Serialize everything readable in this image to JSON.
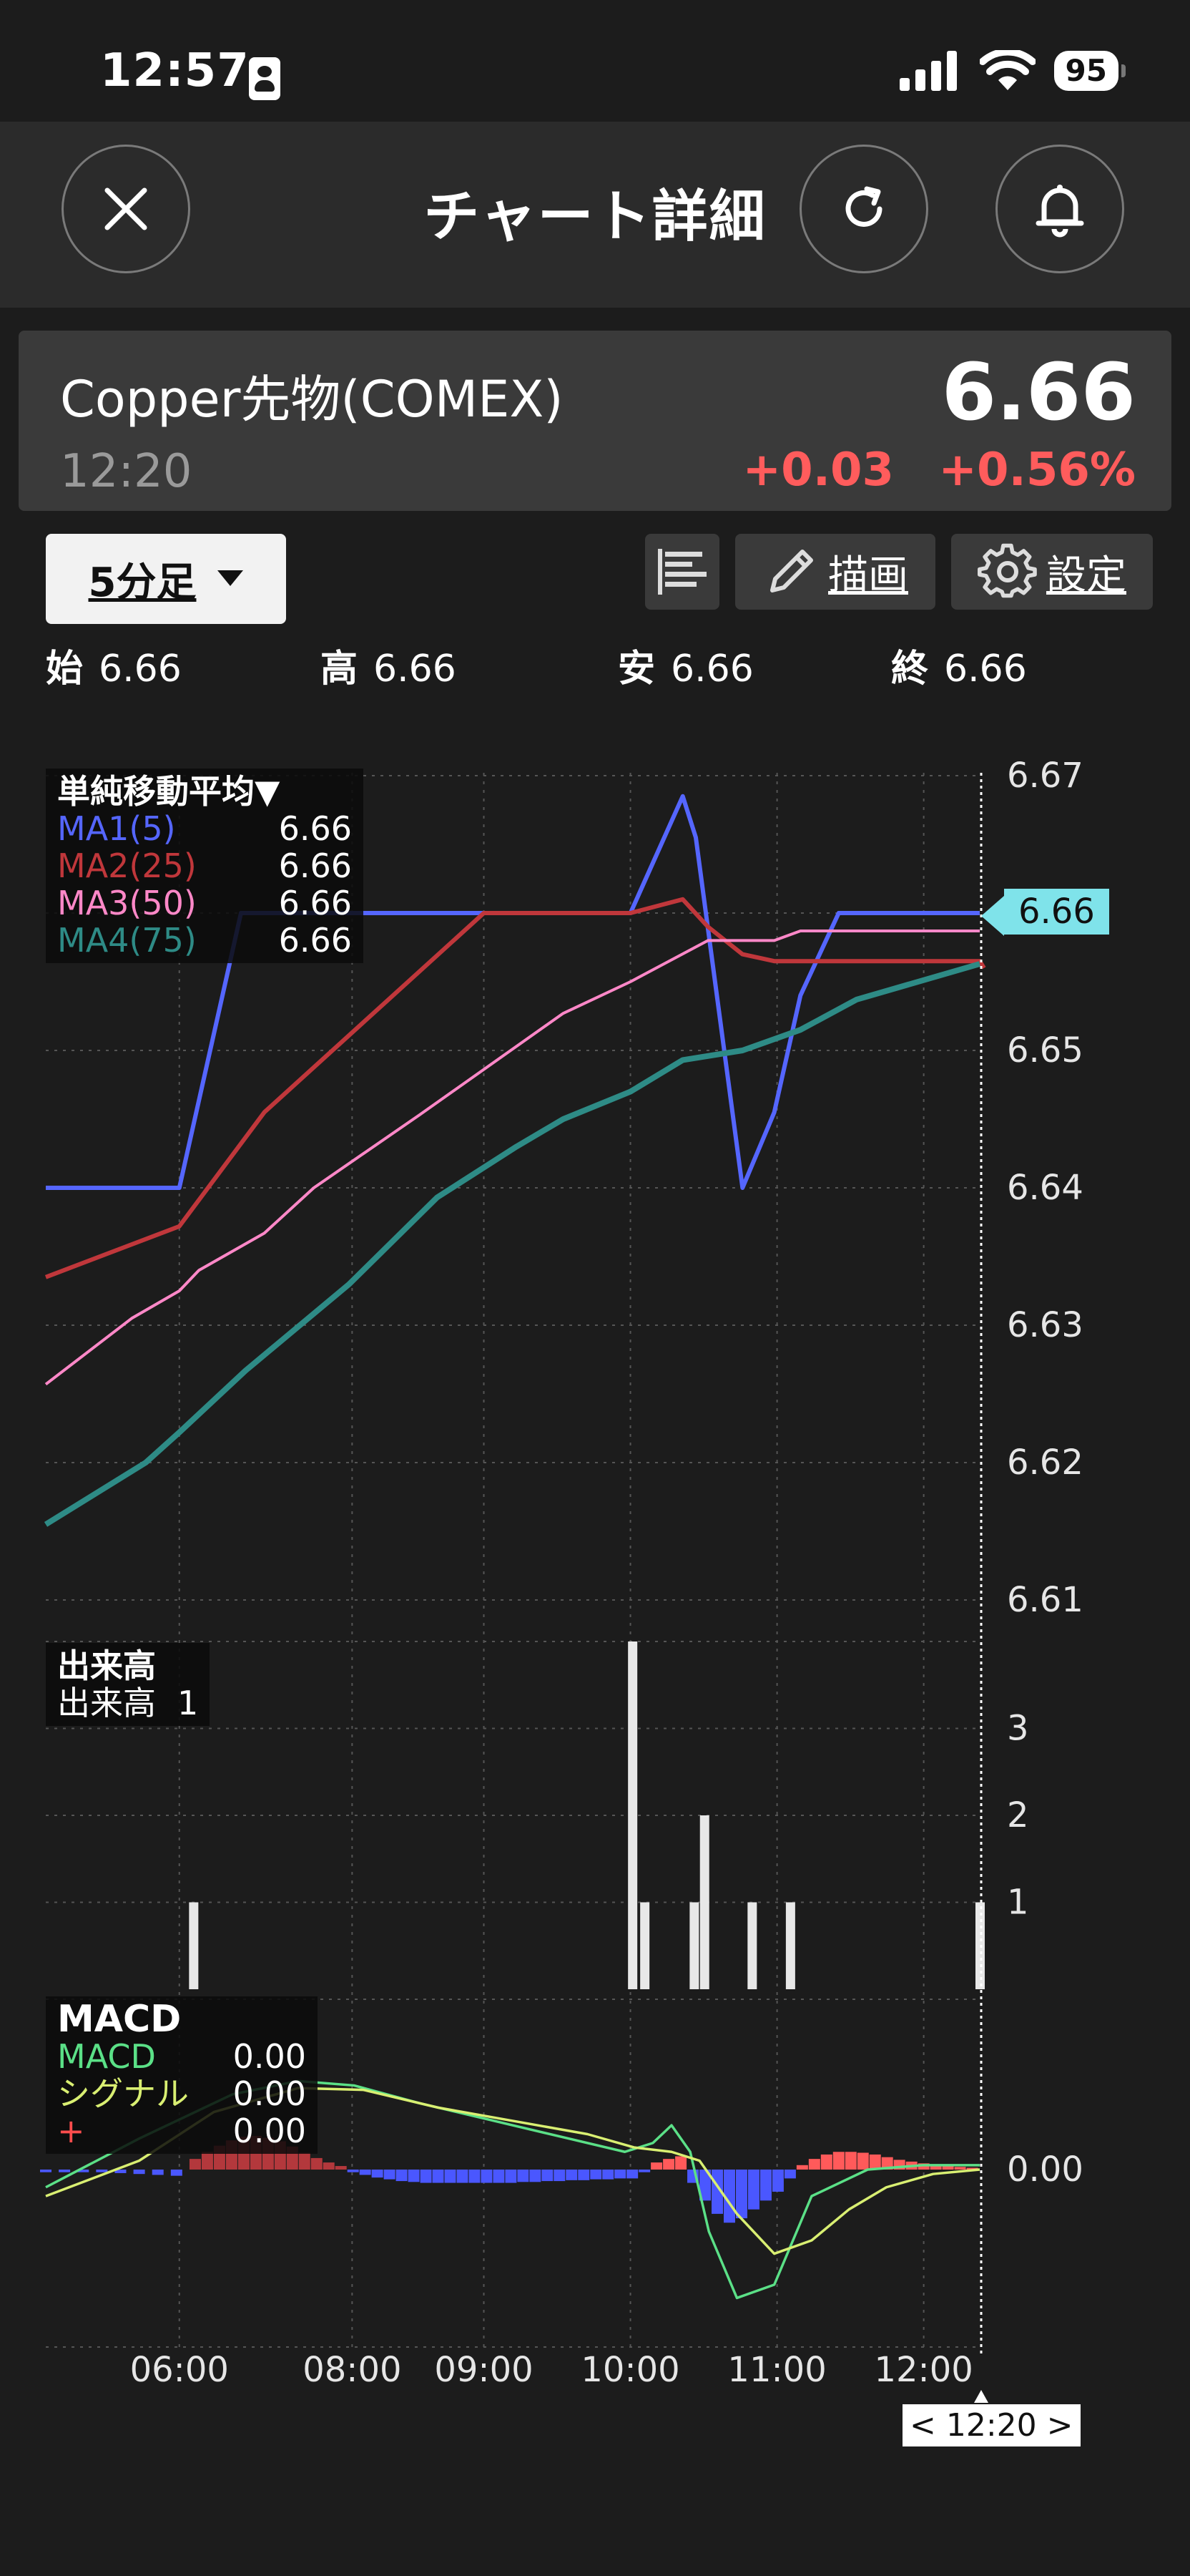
{
  "status_bar": {
    "time": "12:57",
    "battery": "95"
  },
  "header": {
    "title": "チャート詳細"
  },
  "quote": {
    "name": "Copper先物(COMEX)",
    "time": "12:20",
    "price": "6.66",
    "change": "+0.03",
    "change_pct": "+0.56%"
  },
  "toolbar": {
    "timeframe": "5分足",
    "draw_label": "描画",
    "settings_label": "設定"
  },
  "ohlc": [
    {
      "label": "始",
      "value": "6.66"
    },
    {
      "label": "高",
      "value": "6.66"
    },
    {
      "label": "安",
      "value": "6.66"
    },
    {
      "label": "終",
      "value": "6.66"
    }
  ],
  "legend_ma": {
    "title": "単純移動平均▼",
    "rows": [
      {
        "name": "MA1(5)",
        "value": "6.66",
        "color": "#5566ff"
      },
      {
        "name": "MA2(25)",
        "value": "6.66",
        "color": "#c0373b"
      },
      {
        "name": "MA3(50)",
        "value": "6.66",
        "color": "#ff88c8"
      },
      {
        "name": "MA4(75)",
        "value": "6.66",
        "color": "#2e8b86"
      }
    ]
  },
  "legend_volume": {
    "title": "出来高",
    "label": "出来高",
    "value": "1"
  },
  "legend_macd": {
    "title": "MACD",
    "rows": [
      {
        "name": "MACD",
        "value": "0.00",
        "color": "#5be087"
      },
      {
        "name": "シグナル",
        "value": "0.00",
        "color": "#d9ef72"
      },
      {
        "name": "+",
        "value": "0.00",
        "color": "#ff4d4d"
      }
    ]
  },
  "last_price_tag": "6.66",
  "cursor_time": "< 12:20 >",
  "chart_data": {
    "type": "line",
    "x_ticks": [
      "06:00",
      "08:00",
      "09:00",
      "10:00",
      "11:00",
      "12:00"
    ],
    "price_axis": {
      "ticks": [
        "6.67",
        "6.66",
        "6.65",
        "6.64",
        "6.63",
        "6.62",
        "6.61"
      ],
      "ylim": [
        6.61,
        6.67
      ]
    },
    "volume_axis": {
      "ticks": [
        "3",
        "2",
        "1"
      ],
      "ylim": [
        0,
        4
      ]
    },
    "macd_axis": {
      "ticks": [
        "0.00"
      ]
    },
    "x_range": [
      0,
      100
    ],
    "grid": true,
    "series": [
      {
        "name": "MA1(5)",
        "color": "#5566ff",
        "width": 6,
        "points": [
          [
            0,
            6.64
          ],
          [
            14.3,
            6.64
          ],
          [
            20.9,
            6.66
          ],
          [
            46.9,
            6.66
          ],
          [
            62.6,
            6.66
          ],
          [
            68.2,
            6.6685
          ],
          [
            69.6,
            6.6655
          ],
          [
            74.6,
            6.64
          ],
          [
            78.0,
            6.6455
          ],
          [
            80.8,
            6.654
          ],
          [
            84.9,
            6.66
          ],
          [
            100,
            6.66
          ]
        ]
      },
      {
        "name": "MA2(25)",
        "color": "#c0373b",
        "width": 6,
        "points": [
          [
            0,
            6.6335
          ],
          [
            14.3,
            6.6372
          ],
          [
            23.4,
            6.6455
          ],
          [
            46.9,
            6.66
          ],
          [
            62.6,
            6.66
          ],
          [
            68.2,
            6.661
          ],
          [
            70.9,
            6.659
          ],
          [
            74.6,
            6.657
          ],
          [
            78.0,
            6.6565
          ],
          [
            100,
            6.6565
          ],
          [
            104.3,
            6.656
          ]
        ]
      },
      {
        "name": "MA3(50)",
        "color": "#ff88c8",
        "width": 4,
        "points": [
          [
            0,
            6.6257
          ],
          [
            9.2,
            6.6305
          ],
          [
            14.3,
            6.6325
          ],
          [
            16.4,
            6.634
          ],
          [
            23.4,
            6.6367
          ],
          [
            28.7,
            6.64
          ],
          [
            40,
            6.6453
          ],
          [
            55.4,
            6.6527
          ],
          [
            62.6,
            6.655
          ],
          [
            70.9,
            6.658
          ],
          [
            78.0,
            6.658
          ],
          [
            80.8,
            6.6587
          ],
          [
            100,
            6.6587
          ]
        ]
      },
      {
        "name": "MA4(75)",
        "color": "#2e8b86",
        "width": 8,
        "points": [
          [
            0,
            6.6155
          ],
          [
            10.7,
            6.62
          ],
          [
            14.3,
            6.6222
          ],
          [
            21.4,
            6.6267
          ],
          [
            32.5,
            6.633
          ],
          [
            41.9,
            6.6393
          ],
          [
            50.4,
            6.643
          ],
          [
            55.4,
            6.645
          ],
          [
            62.6,
            6.647
          ],
          [
            68.2,
            6.6493
          ],
          [
            74.6,
            6.65
          ],
          [
            80.8,
            6.6515
          ],
          [
            86.8,
            6.6537
          ],
          [
            100,
            6.6563
          ]
        ]
      }
    ],
    "volume_bars": [
      [
        15.8,
        1
      ],
      [
        62.8,
        4
      ],
      [
        64.1,
        1
      ],
      [
        69.4,
        1
      ],
      [
        70.5,
        2
      ],
      [
        75.6,
        1
      ],
      [
        79.7,
        1
      ],
      [
        100,
        1
      ]
    ],
    "macd_lines": [
      {
        "name": "MACD",
        "color": "#5be087",
        "points": [
          [
            0,
            -0.2
          ],
          [
            10,
            0.35
          ],
          [
            20,
            0.85
          ],
          [
            27,
            1.0
          ],
          [
            33,
            0.95
          ],
          [
            40,
            0.75
          ],
          [
            48,
            0.55
          ],
          [
            56,
            0.35
          ],
          [
            62,
            0.2
          ],
          [
            65,
            0.3
          ],
          [
            67,
            0.5
          ],
          [
            69,
            0.2
          ],
          [
            71,
            -0.7
          ],
          [
            74,
            -1.45
          ],
          [
            78,
            -1.3
          ],
          [
            82,
            -0.3
          ],
          [
            88,
            0.0
          ],
          [
            94,
            0.05
          ],
          [
            100,
            0.05
          ]
        ]
      },
      {
        "name": "シグナル",
        "color": "#d9ef72",
        "points": [
          [
            0,
            -0.3
          ],
          [
            10,
            0.1
          ],
          [
            18,
            0.65
          ],
          [
            27,
            0.92
          ],
          [
            34,
            0.9
          ],
          [
            42,
            0.7
          ],
          [
            50,
            0.55
          ],
          [
            58,
            0.4
          ],
          [
            63,
            0.25
          ],
          [
            67,
            0.2
          ],
          [
            70,
            0.1
          ],
          [
            74,
            -0.5
          ],
          [
            78,
            -0.95
          ],
          [
            82,
            -0.8
          ],
          [
            86,
            -0.45
          ],
          [
            90,
            -0.2
          ],
          [
            95,
            -0.05
          ],
          [
            100,
            0.0
          ]
        ]
      }
    ],
    "macd_hist": [
      [
        0,
        -0.03
      ],
      [
        2,
        -0.03
      ],
      [
        4,
        -0.03
      ],
      [
        6,
        -0.03
      ],
      [
        8,
        -0.04
      ],
      [
        10,
        -0.05
      ],
      [
        12,
        -0.06
      ],
      [
        14,
        -0.07
      ],
      [
        16,
        0.12
      ],
      [
        17.3,
        0.2
      ],
      [
        18.6,
        0.27
      ],
      [
        19.9,
        0.33
      ],
      [
        21.2,
        0.37
      ],
      [
        22.5,
        0.38
      ],
      [
        23.8,
        0.36
      ],
      [
        25.1,
        0.32
      ],
      [
        26.4,
        0.26
      ],
      [
        27.7,
        0.19
      ],
      [
        29,
        0.13
      ],
      [
        30.3,
        0.08
      ],
      [
        31.6,
        0.04
      ],
      [
        32.9,
        -0.03
      ],
      [
        34.2,
        -0.06
      ],
      [
        35.5,
        -0.09
      ],
      [
        36.8,
        -0.11
      ],
      [
        38.1,
        -0.13
      ],
      [
        39.4,
        -0.14
      ],
      [
        40.7,
        -0.15
      ],
      [
        42,
        -0.15
      ],
      [
        43.3,
        -0.15
      ],
      [
        44.6,
        -0.15
      ],
      [
        45.9,
        -0.15
      ],
      [
        47.2,
        -0.15
      ],
      [
        48.5,
        -0.15
      ],
      [
        49.8,
        -0.15
      ],
      [
        51.1,
        -0.14
      ],
      [
        52.4,
        -0.14
      ],
      [
        53.7,
        -0.13
      ],
      [
        55,
        -0.13
      ],
      [
        56.3,
        -0.12
      ],
      [
        57.6,
        -0.12
      ],
      [
        58.9,
        -0.11
      ],
      [
        60.2,
        -0.11
      ],
      [
        61.5,
        -0.1
      ],
      [
        62.8,
        -0.1
      ],
      [
        64.1,
        -0.03
      ],
      [
        65.4,
        0.08
      ],
      [
        66.7,
        0.12
      ],
      [
        68,
        0.15
      ],
      [
        69.3,
        -0.15
      ],
      [
        70.6,
        -0.35
      ],
      [
        71.9,
        -0.5
      ],
      [
        73.2,
        -0.6
      ],
      [
        74.5,
        -0.55
      ],
      [
        75.8,
        -0.45
      ],
      [
        77.1,
        -0.35
      ],
      [
        78.4,
        -0.25
      ],
      [
        79.7,
        -0.1
      ],
      [
        81,
        0.05
      ],
      [
        82.3,
        0.12
      ],
      [
        83.6,
        0.17
      ],
      [
        84.9,
        0.2
      ],
      [
        86.2,
        0.2
      ],
      [
        87.5,
        0.19
      ],
      [
        88.8,
        0.17
      ],
      [
        90.1,
        0.14
      ],
      [
        91.4,
        0.11
      ],
      [
        92.7,
        0.09
      ],
      [
        94,
        0.07
      ],
      [
        95.3,
        0.05
      ],
      [
        96.6,
        0.04
      ],
      [
        97.9,
        0.03
      ],
      [
        99.2,
        0.02
      ]
    ],
    "macd_ylim": [
      -2.0,
      1.6
    ]
  }
}
